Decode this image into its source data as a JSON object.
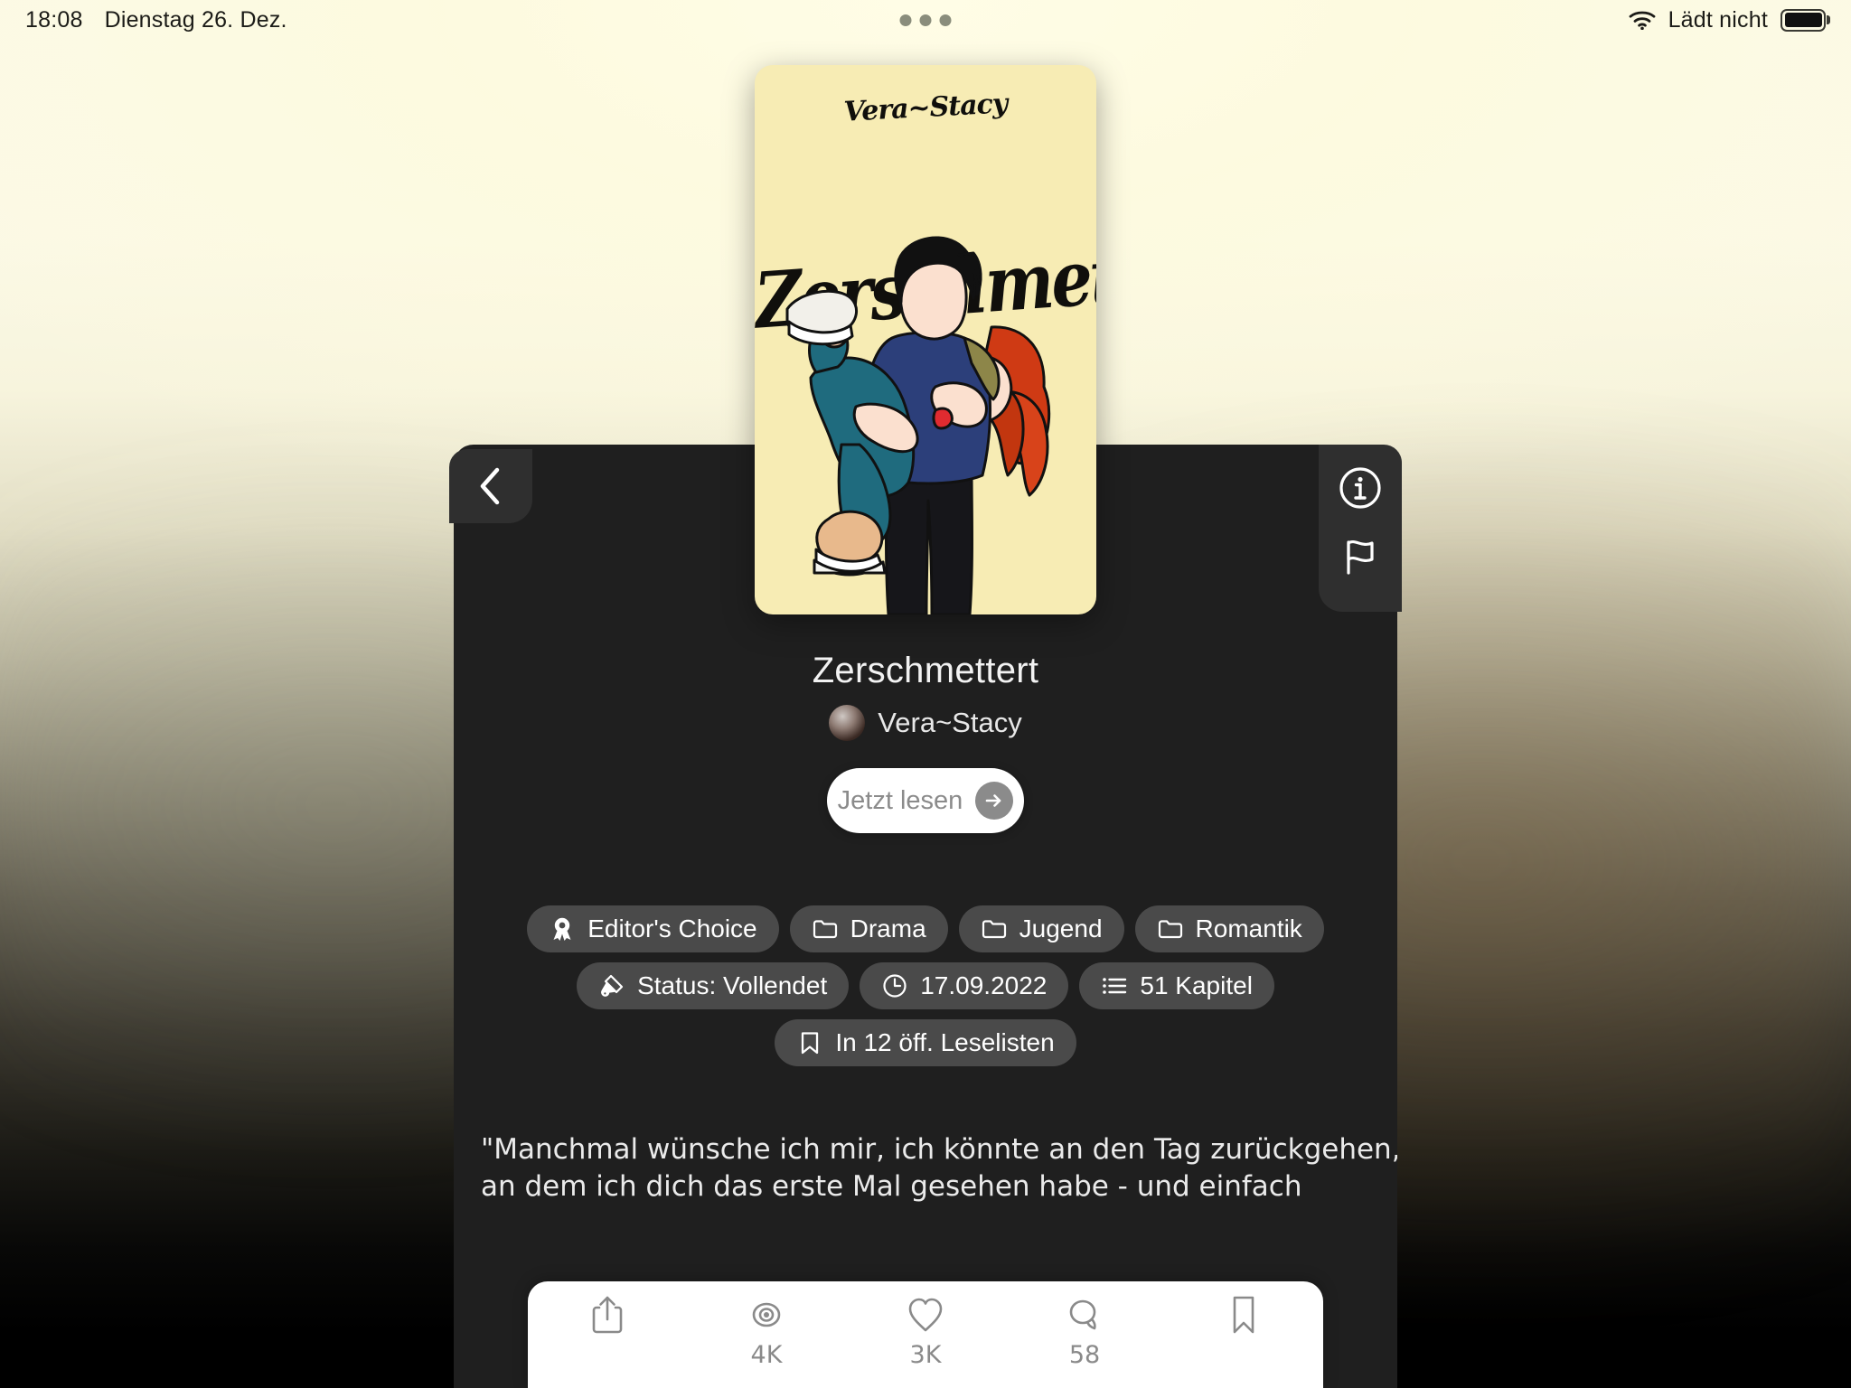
{
  "status_bar": {
    "time": "18:08",
    "date": "Dienstag 26. Dez.",
    "battery_label": "Lädt nicht",
    "wifi_icon": "wifi-icon",
    "battery_icon": "battery-icon",
    "multitask_indicator": "multitask-dots"
  },
  "cover": {
    "author_script": "Vera~Stacy",
    "title_script": "Zerschmettert",
    "background_color": "#f7ecb4"
  },
  "nav": {
    "back_icon": "chevron-left-icon",
    "info_icon": "info-circle-icon",
    "report_icon": "flag-icon"
  },
  "book": {
    "title": "Zerschmettert",
    "author": "Vera~Stacy",
    "read_button_label": "Jetzt lesen",
    "read_button_icon": "arrow-right-icon"
  },
  "tags": [
    {
      "label": "Editor's Choice",
      "icon": "award-icon"
    },
    {
      "label": "Drama",
      "icon": "folder-icon"
    },
    {
      "label": "Jugend",
      "icon": "folder-icon"
    },
    {
      "label": "Romantik",
      "icon": "folder-icon"
    },
    {
      "label": "Status: Vollendet",
      "icon": "paintbrush-icon"
    },
    {
      "label": "17.09.2022",
      "icon": "clock-icon"
    },
    {
      "label": "51 Kapitel",
      "icon": "list-icon"
    },
    {
      "label": "In 12 öff. Leselisten",
      "icon": "bookmark-icon"
    }
  ],
  "description": {
    "line1": "\"Manchmal wünsche ich mir, ich könnte an den Tag zurückgehen,",
    "line2": "an dem ich dich das erste Mal gesehen habe - und einfach"
  },
  "toolbar": [
    {
      "name": "share",
      "icon": "share-icon",
      "label": ""
    },
    {
      "name": "views",
      "icon": "eye-icon",
      "label": "4K"
    },
    {
      "name": "likes",
      "icon": "heart-icon",
      "label": "3K"
    },
    {
      "name": "comments",
      "icon": "comment-icon",
      "label": "58"
    },
    {
      "name": "bookmark",
      "icon": "bookmark-icon",
      "label": ""
    }
  ],
  "colors": {
    "panel_bg": "#1f1f1f",
    "tag_bg": "#4a4a4a",
    "accent_white": "#ffffff",
    "cover_yellow": "#f7ecb4",
    "rail_bg": "#2f2f2f"
  }
}
